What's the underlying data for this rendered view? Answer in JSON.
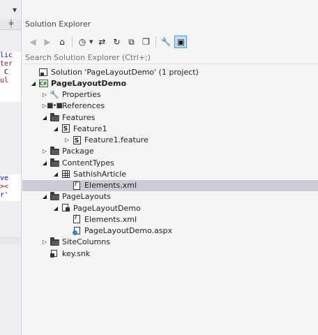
{
  "panel": {
    "title": "Solution Explorer",
    "search_placeholder": "Search Solution Explorer (Ctrl+;)"
  },
  "toolbar": [
    {
      "name": "back-icon",
      "glyph": "◀",
      "disabled": true
    },
    {
      "name": "forward-icon",
      "glyph": "▶",
      "disabled": true
    },
    {
      "name": "home-icon",
      "glyph": "⌂",
      "disabled": false
    },
    {
      "name": "sep"
    },
    {
      "name": "pending-changes-filter-icon",
      "glyph": "◷",
      "disabled": false,
      "caret": true
    },
    {
      "name": "sync-with-document-icon",
      "glyph": "⇄",
      "disabled": false
    },
    {
      "name": "refresh-icon",
      "glyph": "↻",
      "disabled": false
    },
    {
      "name": "collapse-all-icon",
      "glyph": "⧉",
      "disabled": false
    },
    {
      "name": "show-all-files-icon",
      "glyph": "❐",
      "disabled": false
    },
    {
      "name": "sep"
    },
    {
      "name": "properties-wrench-icon",
      "glyph": "🔧",
      "disabled": false
    },
    {
      "name": "preview-selected-items-icon",
      "glyph": "▣",
      "disabled": false,
      "active": true
    }
  ],
  "tree": [
    {
      "label": "Solution 'PageLayoutDemo' (1 project)",
      "level": 0,
      "arrow": "",
      "icon": "sol"
    },
    {
      "label": "PageLayoutDemo",
      "level": 0,
      "arrow": "open",
      "icon": "csproj",
      "bold": true
    },
    {
      "label": "Properties",
      "level": 1,
      "arrow": "closed",
      "icon": "wrench"
    },
    {
      "label": "References",
      "level": 1,
      "arrow": "closed",
      "icon": "refs"
    },
    {
      "label": "Features",
      "level": 1,
      "arrow": "open",
      "icon": "folder"
    },
    {
      "label": "Feature1",
      "level": 2,
      "arrow": "open",
      "icon": "sbox"
    },
    {
      "label": "Feature1.feature",
      "level": 3,
      "arrow": "closed",
      "icon": "sbox"
    },
    {
      "label": "Package",
      "level": 1,
      "arrow": "closed",
      "icon": "folder"
    },
    {
      "label": "ContentTypes",
      "level": 1,
      "arrow": "open",
      "icon": "folder"
    },
    {
      "label": "SathishArticle",
      "level": 2,
      "arrow": "open",
      "icon": "grid"
    },
    {
      "label": "Elements.xml",
      "level": 3,
      "arrow": "",
      "icon": "doc",
      "selected": true
    },
    {
      "label": "PageLayouts",
      "level": 1,
      "arrow": "open",
      "icon": "folder"
    },
    {
      "label": "PageLayoutDemo",
      "level": 2,
      "arrow": "open",
      "icon": "pl"
    },
    {
      "label": "Elements.xml",
      "level": 3,
      "arrow": "",
      "icon": "doc"
    },
    {
      "label": "PageLayoutDemo.aspx",
      "level": 3,
      "arrow": "",
      "icon": "aspx"
    },
    {
      "label": "SiteColumns",
      "level": 1,
      "arrow": "closed",
      "icon": "folder"
    },
    {
      "label": "key.snk",
      "level": 1,
      "arrow": "",
      "icon": "key"
    }
  ],
  "editor": {
    "code_lines_top": [
      "lic",
      "ter",
      " C",
      "ul"
    ],
    "code_lines_bottom": [
      "ve",
      "><",
      "r'"
    ]
  },
  "colors": {
    "selection": "#cacbd5",
    "active_button_border": "#3399ff"
  }
}
